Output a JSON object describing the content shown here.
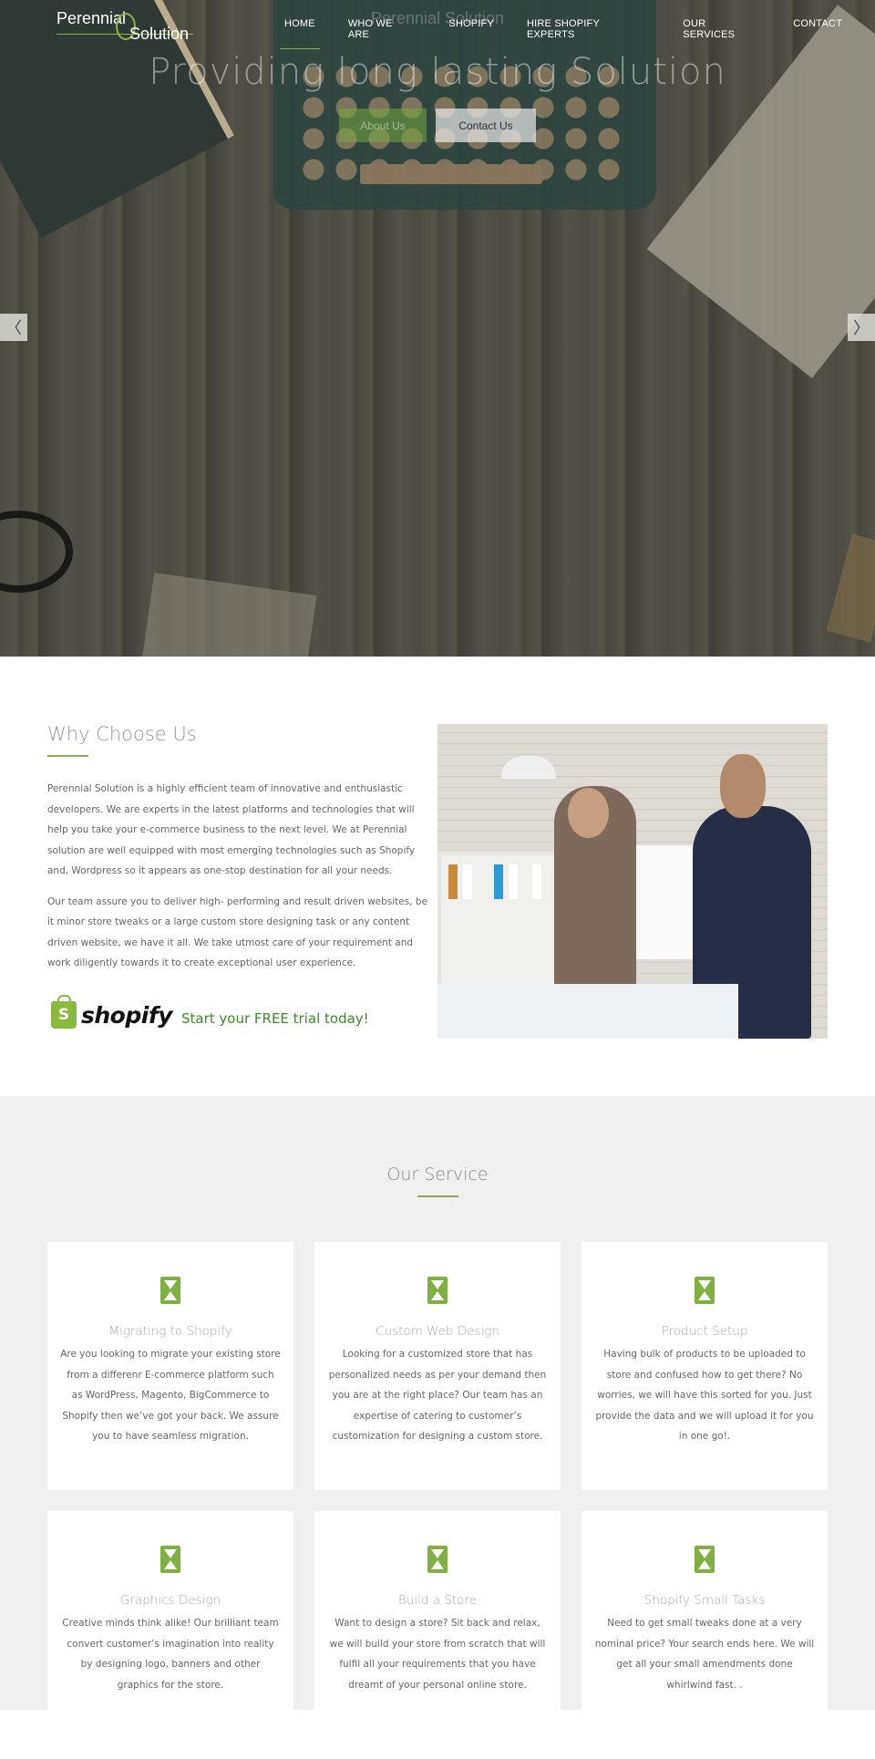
{
  "brand": {
    "line1": "Perennial",
    "line2": "Solution",
    "accent_color": "#8fb04a"
  },
  "nav": {
    "items": [
      {
        "label": "HOME",
        "active": true
      },
      {
        "label": "WHO WE ARE"
      },
      {
        "label": "SHOPIFY"
      },
      {
        "label": "HIRE SHOPIFY EXPERTS"
      },
      {
        "label": "OUR SERVICES"
      },
      {
        "label": "CONTACT"
      }
    ]
  },
  "hero": {
    "subtitle": "Perennial Solution",
    "title": "Providing long lasting Solution",
    "about_button": "About Us",
    "contact_button": "Contact Us",
    "prev_arrow": "〈",
    "next_arrow": "〉"
  },
  "why": {
    "title": "Why Choose Us",
    "paragraphs": [
      "Perennial Solution is a highly efficient team of innovative and enthusiastic developers. We are experts in the latest platforms and technologies that will help you take your e-commerce business to the next level. We at Perennial solution are well equipped with most emerging technologies such as Shopify and, Wordpress so it appears as one-stop destination for all your needs.",
      "Our team assure you to deliver high- performing and result driven websites, be it minor store tweaks or a large custom store designing task or any content driven website, we have it all. We take utmost care of your requirement and work diligently towards it to create exceptional user experience."
    ],
    "shopify_logo_letter": "S",
    "shopify_wordmark": "shopify",
    "shopify_cta": "Start your FREE trial today!"
  },
  "services": {
    "title": "Our Service",
    "cards": [
      {
        "title": "Migrating to Shopify",
        "desc": "Are you looking to migrate your existing store from a differenr E-commerce platform such as WordPress, Magento, BigCommerce to Shopify then we’ve got your back. We assure you to have seamless migration."
      },
      {
        "title": "Custom Web Design",
        "desc": "Looking for a customized store that has personalized needs as per your demand then you are at the right place? Our team has an expertise of catering to customer’s customization for designing a custom store."
      },
      {
        "title": "Product Setup",
        "desc": "Having bulk of products to be uploaded to store and confused how to get there? No worries, we will have this sorted for you. Just provide the data and we will upload it for you in one go!."
      },
      {
        "title": "Graphics Design",
        "desc": "Creative minds think alike! Our brilliant team convert customer’s imagination into reality by designing logo, banners and other graphics for the store."
      },
      {
        "title": "Build a Store",
        "desc": "Want to design a store? Sit back and relax, we will build your store from scratch that will fulfil all your requirements that you have dreamt of your personal online store."
      },
      {
        "title": "Shopify Small Tasks",
        "desc": "Need to get small tweaks done at a very nominal price? Your search ends here. We will get all your small amendments done whirlwind fast. ."
      }
    ]
  }
}
